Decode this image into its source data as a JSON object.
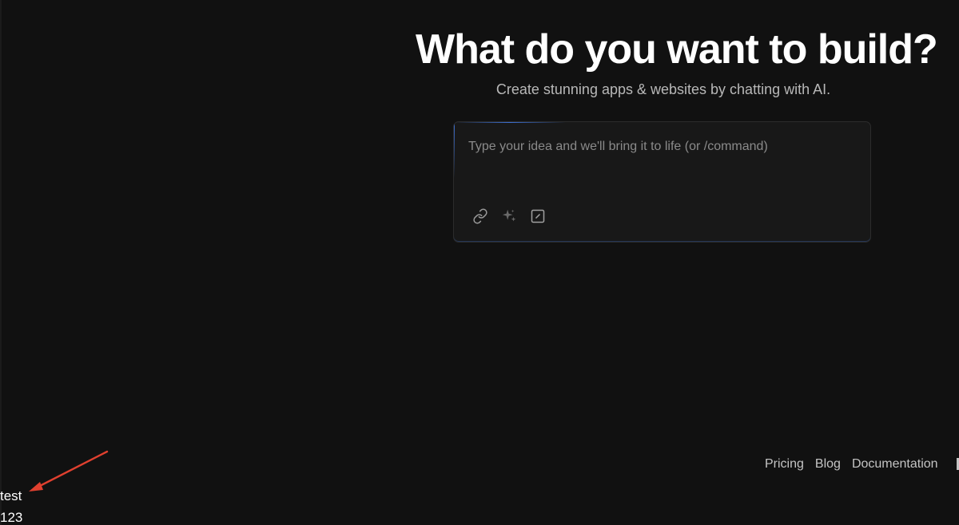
{
  "hero": {
    "title": "What do you want to build?",
    "subtitle": "Create stunning apps & websites by chatting with AI."
  },
  "prompt": {
    "placeholder": "Type your idea and we'll bring it to life (or /command)",
    "value": "",
    "tools": [
      {
        "icon": "link-icon"
      },
      {
        "icon": "sparkle-icon"
      },
      {
        "icon": "edit-square-icon"
      }
    ]
  },
  "footer": {
    "links": [
      "Pricing",
      "Blog",
      "Documentation"
    ]
  },
  "debug": {
    "line1": "test",
    "line2": "123"
  },
  "colors": {
    "background": "#111111",
    "accent": "#3d6fd1",
    "annotation": "#e0402f"
  }
}
